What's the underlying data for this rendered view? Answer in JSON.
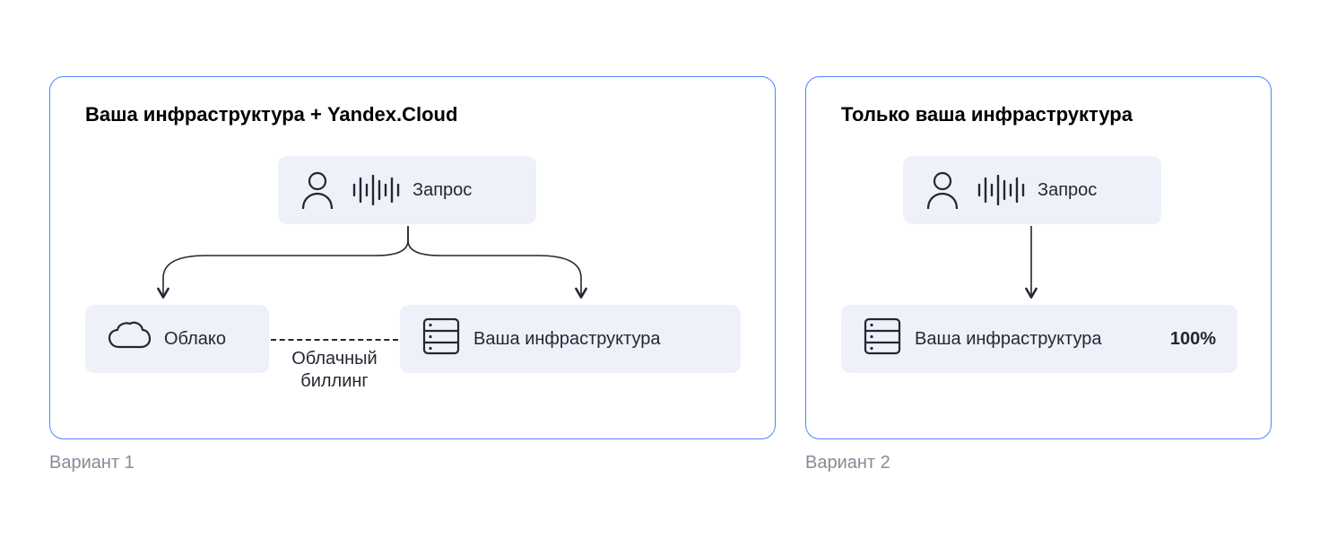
{
  "colors": {
    "panel_border": "#4a86ff",
    "node_bg": "#eef1fa",
    "ink": "#262633",
    "caption": "#8a8a99"
  },
  "icons": {
    "user": "user-icon",
    "voice": "voice-wave-icon",
    "cloud": "cloud-icon",
    "server": "server-icon"
  },
  "variant1": {
    "title": "Ваша инфраструктура + Yandex.Cloud",
    "request_label": "Запрос",
    "cloud_label": "Облако",
    "infra_label": "Ваша инфраструктура",
    "cloud_billing_line1": "Облачный",
    "cloud_billing_line2": "биллинг",
    "caption": "Вариант 1"
  },
  "variant2": {
    "title": "Только ваша инфраструктура",
    "request_label": "Запрос",
    "infra_label": "Ваша инфраструктура",
    "infra_percent": "100%",
    "caption": "Вариант 2"
  }
}
